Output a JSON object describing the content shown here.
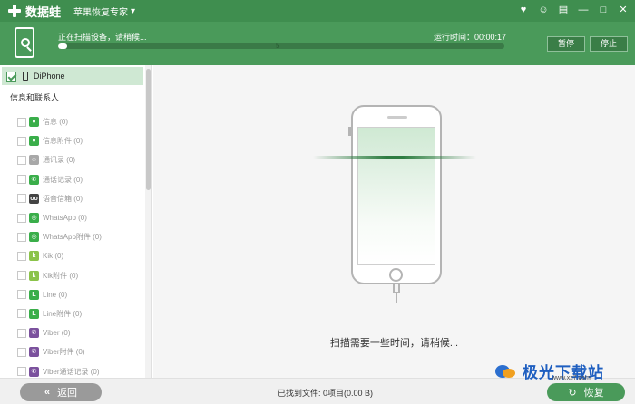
{
  "titlebar": {
    "app_name": "数据蛙",
    "menu_label": "苹果恢复专家",
    "menu_caret": "▾",
    "controls": [
      "♥",
      "☺",
      "▤",
      "—",
      "□",
      "✕"
    ]
  },
  "header": {
    "status": "正在扫描设备，请稍候...",
    "elapsed_label": "运行时间：00:00:17",
    "progress_value": "5",
    "progress_fraction": 0.02,
    "pause_label": "暂停",
    "stop_label": "停止"
  },
  "sidebar": {
    "device_name": "DiPhone",
    "section_title": "信息和联系人",
    "items": [
      {
        "label": "信息 (0)",
        "icon": "message-icon",
        "color": "#3aae4a",
        "glyph": "●"
      },
      {
        "label": "信息附件 (0)",
        "icon": "message-attachment-icon",
        "color": "#3aae4a",
        "glyph": "●"
      },
      {
        "label": "通讯录 (0)",
        "icon": "contacts-icon",
        "color": "#a8a8a8",
        "glyph": "☺"
      },
      {
        "label": "通话记录 (0)",
        "icon": "call-log-icon",
        "color": "#3aae4a",
        "glyph": "✆"
      },
      {
        "label": "语音信箱 (0)",
        "icon": "voicemail-icon",
        "color": "#444444",
        "glyph": "oo"
      },
      {
        "label": "WhatsApp (0)",
        "icon": "whatsapp-icon",
        "color": "#3aae4a",
        "glyph": "◎"
      },
      {
        "label": "WhatsApp附件 (0)",
        "icon": "whatsapp-attachment-icon",
        "color": "#3aae4a",
        "glyph": "◎"
      },
      {
        "label": "Kik (0)",
        "icon": "kik-icon",
        "color": "#8bc34a",
        "glyph": "k"
      },
      {
        "label": "Kik附件 (0)",
        "icon": "kik-attachment-icon",
        "color": "#8bc34a",
        "glyph": "k"
      },
      {
        "label": "Line (0)",
        "icon": "line-icon",
        "color": "#3aae4a",
        "glyph": "L"
      },
      {
        "label": "Line附件 (0)",
        "icon": "line-attachment-icon",
        "color": "#3aae4a",
        "glyph": "L"
      },
      {
        "label": "Viber (0)",
        "icon": "viber-icon",
        "color": "#7b519d",
        "glyph": "✆"
      },
      {
        "label": "Viber附件 (0)",
        "icon": "viber-attachment-icon",
        "color": "#7b519d",
        "glyph": "✆"
      },
      {
        "label": "Viber通话记录 (0)",
        "icon": "viber-call-log-icon",
        "color": "#7b519d",
        "glyph": "✆"
      }
    ]
  },
  "main": {
    "scan_message": "扫描需要一些时间，请稍候..."
  },
  "footer": {
    "back_arrows": "«",
    "back_label": "返回",
    "found_text": "已找到文件: 0项目(0.00 B)",
    "recover_icon": "↻",
    "recover_label": "恢复"
  },
  "watermark": {
    "text": "极光下载站",
    "sub": "www.xz7.com"
  },
  "colors": {
    "brand_green": "#4a9a5a",
    "titlebar_green": "#3f8e4f",
    "selected_row": "#cfe8d3"
  }
}
